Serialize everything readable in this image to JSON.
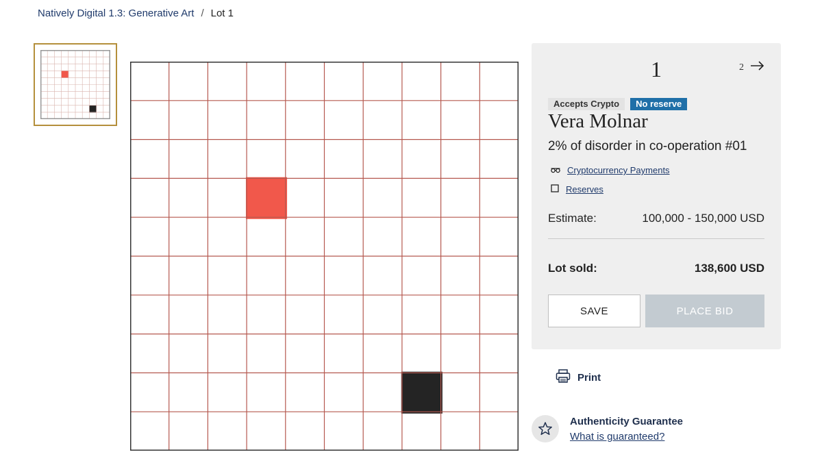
{
  "breadcrumb": {
    "sale": "Natively Digital 1.3: Generative Art",
    "separator": "/",
    "current": "Lot 1"
  },
  "artwork": {
    "grid_rows": 10,
    "grid_cols": 10,
    "grid_color": "#b5584f",
    "filled_cells": [
      {
        "row": 3,
        "col": 3,
        "color": "#f04a3c"
      },
      {
        "row": 8,
        "col": 7,
        "color": "#111111"
      }
    ]
  },
  "thumbnail": {
    "filled_cells": [
      {
        "row": 3,
        "col": 3,
        "color": "#f04a3c"
      },
      {
        "row": 8,
        "col": 7,
        "color": "#111111"
      }
    ]
  },
  "lot": {
    "number": "1",
    "next_number": "2",
    "next_icon": "arrow-right-icon"
  },
  "badges": {
    "crypto": "Accepts Crypto",
    "reserve": "No reserve"
  },
  "artist": "Vera Molnar",
  "title": "2% of disorder in co-operation #01",
  "links": {
    "crypto": {
      "label": "Cryptocurrency Payments",
      "icon": "glasses-icon"
    },
    "reserves": {
      "label": "Reserves",
      "icon": "checkbox-icon"
    }
  },
  "estimate": {
    "label": "Estimate:",
    "value": "100,000 - 150,000 USD"
  },
  "sold": {
    "label": "Lot sold:",
    "value": "138,600 USD"
  },
  "buttons": {
    "save": "SAVE",
    "place_bid": "PLACE BID"
  },
  "print": {
    "label": "Print",
    "icon": "printer-icon"
  },
  "authenticity": {
    "title": "Authenticity Guarantee",
    "link": "What is guaranteed?",
    "icon": "star-icon"
  },
  "colors": {
    "accent_blue": "#1f6fa8",
    "thumbnail_border": "#b48f3b",
    "panel_bg": "#efefef",
    "disabled_button": "#c3cbd1"
  }
}
